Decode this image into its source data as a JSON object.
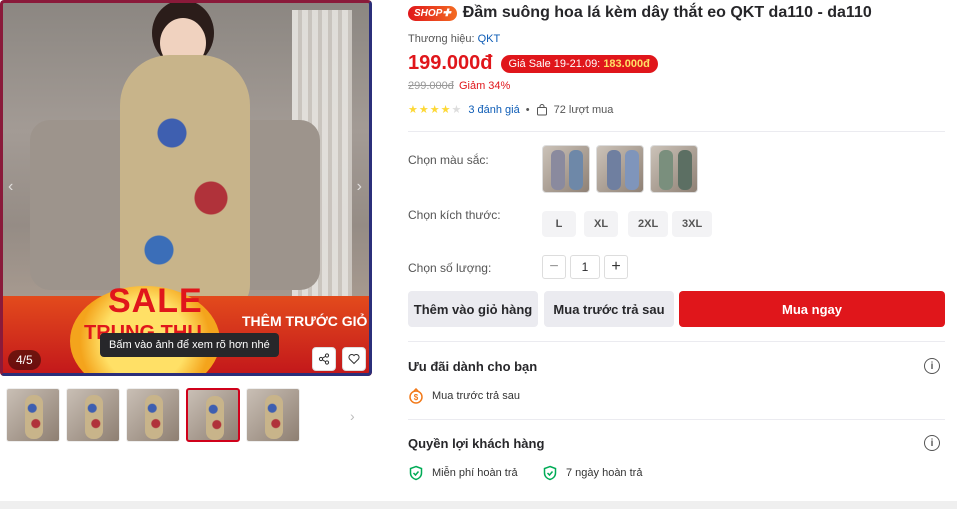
{
  "gallery": {
    "counter": "4/5",
    "tooltip": "Bấm vào ảnh để xem rõ hơn nhé",
    "banner_sale": "SALE",
    "banner_sub": "TRUNG THU",
    "banner_promo": "THÊM TRƯỚC GIỎ HÀNG",
    "thumbnail_count": 5,
    "active_thumbnail": 4
  },
  "product": {
    "shop_badge": "SHOP✚",
    "title": "Đầm suông hoa lá kèm dây thắt eo QKT da110 - da110",
    "brand_label": "Thương hiệu: ",
    "brand_name": "QKT",
    "price": "199.000đ",
    "sale_tag_label": "Giá Sale 19-21.09: ",
    "sale_tag_price": "183.000đ",
    "old_price": "299.000đ",
    "discount": "Giảm 34%",
    "rating": 4,
    "review_link": "3 đánh giá",
    "sold": "72 lượt mua"
  },
  "options": {
    "color_label": "Chọn màu sắc:",
    "size_label": "Chọn kích thước:",
    "sizes": [
      "L",
      "XL",
      "2XL",
      "3XL"
    ],
    "quantity_label": "Chọn số lượng:",
    "quantity": "1"
  },
  "actions": {
    "add_to_cart": "Thêm vào giỏ hàng",
    "buy_later": "Mua trước trả sau",
    "buy_now": "Mua ngay"
  },
  "offers": {
    "title": "Ưu đãi dành cho bạn",
    "item": "Mua trước trả sau"
  },
  "benefits": {
    "title": "Quyền lợi khách hàng",
    "items": [
      "Miễn phí hoàn trả",
      "7 ngày hoàn trả"
    ]
  },
  "colors": {
    "accent": "#e0161b",
    "link": "#0d5cb6",
    "star": "#fdd836",
    "safe_green": "#00ab56"
  }
}
